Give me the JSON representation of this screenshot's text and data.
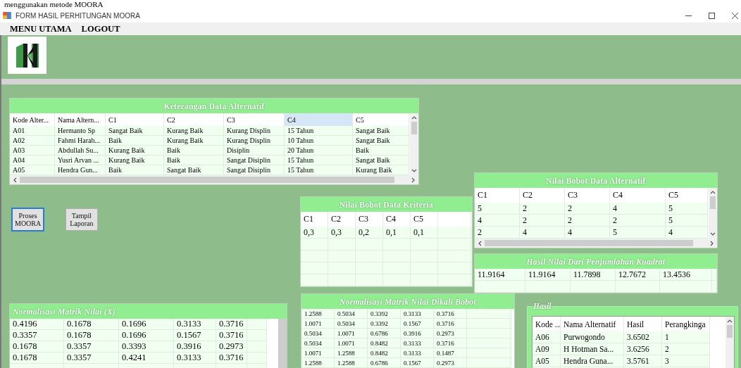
{
  "caption": "menggunakan metode MOORA",
  "window": {
    "title": "FORM HASIL PERHITUNGAN MOORA"
  },
  "menu": [
    {
      "label": "MENU UTAMA"
    },
    {
      "label": "LOGOUT"
    }
  ],
  "alternatives": {
    "title": "Keterangan Data Alternatif",
    "columns": [
      {
        "label": "Kode Alter...",
        "selected": false
      },
      {
        "label": "Nama Altern...",
        "selected": false
      },
      {
        "label": "C1",
        "selected": false
      },
      {
        "label": "C2",
        "selected": false
      },
      {
        "label": "C3",
        "selected": false
      },
      {
        "label": "C4",
        "selected": true
      },
      {
        "label": "C5",
        "selected": false
      }
    ],
    "rows": [
      [
        "A01",
        "Hermanto Sp",
        "Sangat Baik",
        "Kurang Baik",
        "Kurang Displin",
        "15 Tahun",
        "Sangat Baik"
      ],
      [
        "A02",
        "Fahmi Harah...",
        "Baik",
        "Kurang Baik",
        "Kurang Displin",
        "10 Tahun",
        "Sangat Baik"
      ],
      [
        "A03",
        "Abdullah Su...",
        "Kurang Baik",
        "Baik",
        "Disiplin",
        "20 Tahun",
        "Baik"
      ],
      [
        "A04",
        "Yusri Arvan ...",
        "Kurang Baik",
        "Baik",
        "Sangat Disiplin",
        "15 Tahun",
        "Sangat Baik"
      ],
      [
        "A05",
        "Hendra Gun...",
        "Baik",
        "Sangat Baik",
        "Sangat Disiplin",
        "15 Tahun",
        "Kurang Baik"
      ]
    ]
  },
  "buttons": [
    {
      "label": "Proses\nMOORA",
      "focused": true
    },
    {
      "label": "Tampil\nLaporan",
      "focused": false
    }
  ],
  "criteria_weights": {
    "title": "Nilai Bobot Data Kriteria",
    "columns": [
      {
        "label": "C1",
        "selected": false
      },
      {
        "label": "C2",
        "selected": false
      },
      {
        "label": "C3",
        "selected": false
      },
      {
        "label": "C4",
        "selected": false
      },
      {
        "label": "C5",
        "selected": false
      }
    ],
    "rows": [
      [
        "0,3",
        "0,3",
        "0,2",
        "0,1",
        "0,1"
      ]
    ]
  },
  "alternative_weights": {
    "title": "Nilai Bobot Data Alternatif",
    "columns": [
      {
        "label": "C1",
        "selected": false
      },
      {
        "label": "C2",
        "selected": false
      },
      {
        "label": "C3",
        "selected": false
      },
      {
        "label": "C4",
        "selected": false
      },
      {
        "label": "C5",
        "selected": false
      }
    ],
    "rows": [
      [
        "5",
        "2",
        "2",
        "4",
        "5"
      ],
      [
        "4",
        "2",
        "2",
        "2",
        "5"
      ],
      [
        "2",
        "4",
        "4",
        "5",
        "4"
      ]
    ]
  },
  "sum_of_squares": {
    "title": "Hasil Nilai Dari Penjumlahan Kuadrat",
    "rows": [
      [
        "11.9164",
        "11.9164",
        "11.7898",
        "12.7672",
        "13.4536"
      ]
    ]
  },
  "normalized_matrix": {
    "title": "Normalisasi Matrik Nilai (X)",
    "rows": [
      [
        "0.4196",
        "0.1678",
        "0.1696",
        "0.3133",
        "0.3716"
      ],
      [
        "0.3357",
        "0.1678",
        "0.1696",
        "0.1567",
        "0.3716"
      ],
      [
        "0.1678",
        "0.3357",
        "0.3393",
        "0.3916",
        "0.2973"
      ],
      [
        "0.1678",
        "0.3357",
        "0.4241",
        "0.3133",
        "0.3716"
      ]
    ]
  },
  "weighted_matrix": {
    "title": "Normalisasi Matrik Nilai Dikali Bobot",
    "rows": [
      [
        "1.2588",
        "0.5034",
        "0.3392",
        "0.3133",
        "0.3716"
      ],
      [
        "1.0071",
        "0.5034",
        "0.3392",
        "0.1567",
        "0.3716"
      ],
      [
        "0.5034",
        "1.0071",
        "0.6786",
        "0.3916",
        "0.2973"
      ],
      [
        "0.5034",
        "1.0071",
        "0.8482",
        "0.3133",
        "0.3716"
      ],
      [
        "1.0071",
        "1.2588",
        "0.8482",
        "0.3133",
        "0.1487"
      ],
      [
        "1.2588",
        "1.2588",
        "0.6786",
        "0.1567",
        "0.2973"
      ]
    ]
  },
  "result": {
    "title": "Hasil",
    "columns": [
      {
        "label": "Kode ...",
        "selected": false
      },
      {
        "label": "Nama Alternatif",
        "selected": false
      },
      {
        "label": "Hasil",
        "selected": false
      },
      {
        "label": "Perangkinga",
        "selected": false
      }
    ],
    "rows": [
      [
        "A06",
        "Purwogondo",
        "3.6502",
        "1"
      ],
      [
        "A09",
        "H Hotman Sa...",
        "3.6256",
        "2"
      ],
      [
        "A05",
        "Hendra Guna...",
        "3.5761",
        "3"
      ]
    ]
  }
}
